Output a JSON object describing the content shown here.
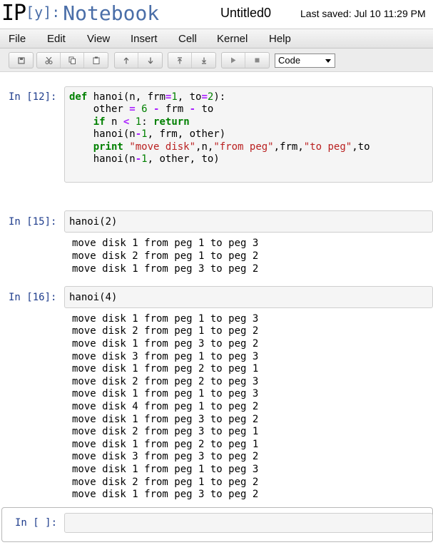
{
  "header": {
    "logo_ip": "IP",
    "logo_y": "[y]:",
    "logo_notebook": "Notebook",
    "title": "Untitled0",
    "last_saved": "Last saved: Jul 10 11:29 PM"
  },
  "menu": [
    "File",
    "Edit",
    "View",
    "Insert",
    "Cell",
    "Kernel",
    "Help"
  ],
  "toolbar": {
    "cell_type": "Code",
    "icons": [
      "save-icon",
      "cut-icon",
      "copy-icon",
      "paste-icon",
      "move-up-icon",
      "move-down-icon",
      "insert-above-icon",
      "insert-below-icon",
      "run-icon",
      "stop-icon"
    ]
  },
  "cells": {
    "c12": {
      "prompt": "In [12]:",
      "code": [
        "def hanoi(n, frm=1, to=2):",
        "    other = 6 - frm - to",
        "    if n < 1: return",
        "    hanoi(n-1, frm, other)",
        "    print \"move disk\",n,\"from peg\",frm,\"to peg\",to",
        "    hanoi(n-1, other, to)"
      ]
    },
    "c15": {
      "prompt": "In [15]:",
      "code": "hanoi(2)",
      "output": [
        "move disk 1 from peg 1 to peg 3",
        "move disk 2 from peg 1 to peg 2",
        "move disk 1 from peg 3 to peg 2"
      ]
    },
    "c16": {
      "prompt": "In [16]:",
      "code": "hanoi(4)",
      "output": [
        "move disk 1 from peg 1 to peg 3",
        "move disk 2 from peg 1 to peg 2",
        "move disk 1 from peg 3 to peg 2",
        "move disk 3 from peg 1 to peg 3",
        "move disk 1 from peg 2 to peg 1",
        "move disk 2 from peg 2 to peg 3",
        "move disk 1 from peg 1 to peg 3",
        "move disk 4 from peg 1 to peg 2",
        "move disk 1 from peg 3 to peg 2",
        "move disk 2 from peg 3 to peg 1",
        "move disk 1 from peg 2 to peg 1",
        "move disk 3 from peg 3 to peg 2",
        "move disk 1 from peg 1 to peg 3",
        "move disk 2 from peg 1 to peg 2",
        "move disk 1 from peg 3 to peg 2"
      ]
    },
    "empty": {
      "prompt": "In [ ]:"
    }
  }
}
